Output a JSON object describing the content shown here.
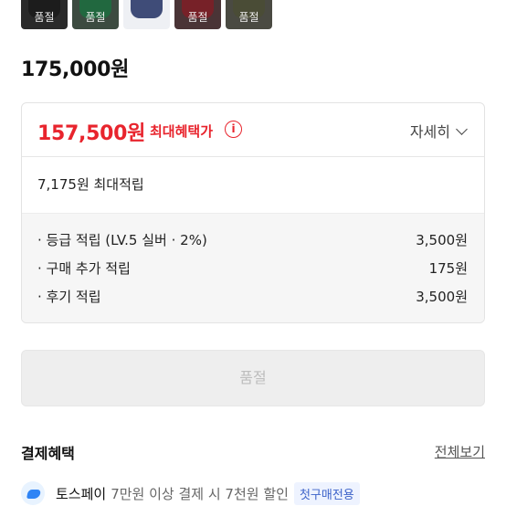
{
  "swatches": [
    {
      "label": "품절",
      "color": "#2a2a2a",
      "garment": "#1b1b1b"
    },
    {
      "label": "품절",
      "color": "#3c4b40",
      "garment": "#1e6b3f"
    },
    {
      "label": "",
      "color": "#eef0f4",
      "garment": "#2b3a6a"
    },
    {
      "label": "품절",
      "color": "#4a3436",
      "garment": "#7c1f27"
    },
    {
      "label": "품절",
      "color": "#4a4a42",
      "garment": "#4a4d35"
    }
  ],
  "list_price": "175,000원",
  "benefit": {
    "max_price": "157,500원",
    "max_price_label": "최대혜택가",
    "info_icon": "ⓘ",
    "detail_label": "자세히",
    "points_total": "7,175원 최대적립",
    "points": [
      {
        "label": "· 등급 적립 (LV.5 실버 · 2%)",
        "value": "3,500원"
      },
      {
        "label": "· 구매 추가 적립",
        "value": "175원"
      },
      {
        "label": "· 후기 적립",
        "value": "3,500원"
      }
    ]
  },
  "soldout_label": "품절",
  "payment": {
    "title": "결제혜택",
    "view_all": "전체보기",
    "toss": {
      "name": "토스페이",
      "desc": "7만원 이상 결제 시 7천원 할인",
      "badge": "첫구매전용"
    }
  },
  "colors": {
    "accent_red": "#e8242d",
    "badge_blue": "#3d63c9",
    "toss_blue": "#2f84f5"
  }
}
